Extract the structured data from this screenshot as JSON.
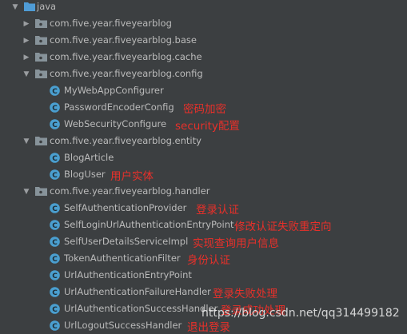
{
  "tree": {
    "root": "java",
    "packages": [
      "com.five.year.fiveyearblog",
      "com.five.year.fiveyearblog.base",
      "com.five.year.fiveyearblog.cache",
      "com.five.year.fiveyearblog.config",
      "com.five.year.fiveyearblog.entity",
      "com.five.year.fiveyearblog.handler"
    ],
    "config_classes": [
      "MyWebAppConfigurer",
      "PasswordEncoderConfig",
      "WebSecurityConfigure"
    ],
    "entity_classes": [
      "BlogArticle",
      "BlogUser"
    ],
    "handler_classes": [
      "SelfAuthenticationProvider",
      "SelfLoginUrlAuthenticationEntryPoint",
      "SelfUserDetailsServiceImpl",
      "TokenAuthenticationFilter",
      "UrlAuthenticationEntryPoint",
      "UrlAuthenticationFailureHandler",
      "UrlAuthenticationSuccessHandler",
      "UrlLogoutSuccessHandler"
    ]
  },
  "annotations": {
    "password_encoder": "密码加密",
    "web_security": "security配置",
    "blog_user": "用户实体",
    "self_auth_provider": "登录认证",
    "self_login_entry": "修改认证失败重定向",
    "self_user_details": "实现查询用户信息",
    "token_filter": "身份认证",
    "failure_handler": "登录失败处理",
    "success_handler": "登录成功处理",
    "logout_handler": "退出登录"
  },
  "watermark": "https://blog.csdn.net/qq314499182",
  "colors": {
    "background": "#3c3f41",
    "text": "#bbbbbb",
    "annotation": "#e8302a",
    "folder": "#87939a",
    "class_icon": "#4a9fd0"
  },
  "icons": {
    "folder": "folder-icon",
    "package": "package-icon",
    "class": "class-icon",
    "expanded": "chevron-down-icon",
    "collapsed": "chevron-right-icon"
  }
}
